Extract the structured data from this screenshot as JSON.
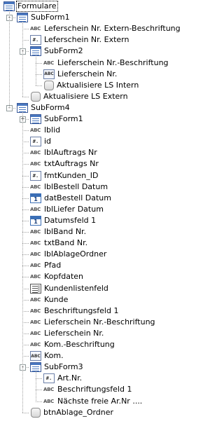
{
  "tree": [
    {
      "label": "Formulare",
      "icon": "form"
    },
    {
      "label": "SubForm1",
      "icon": "form"
    },
    {
      "label": "Leferschein Nr. Extern-Beschriftung",
      "icon": "label"
    },
    {
      "label": "Leferschein Nr. Extern",
      "icon": "textbox"
    },
    {
      "label": "SubForm2",
      "icon": "form"
    },
    {
      "label": "Lieferschein Nr.-Beschriftung",
      "icon": "label"
    },
    {
      "label": "Lieferschein Nr.",
      "icon": "textbox-abc"
    },
    {
      "label": "Aktualisiere LS Intern",
      "icon": "button"
    },
    {
      "label": "Aktualisiere LS Extern",
      "icon": "button"
    },
    {
      "label": "SubForm4",
      "icon": "form"
    },
    {
      "label": "SubForm1",
      "icon": "form"
    },
    {
      "label": "lblid",
      "icon": "label"
    },
    {
      "label": "id",
      "icon": "textbox"
    },
    {
      "label": "lblAuftrags Nr",
      "icon": "label"
    },
    {
      "label": "txtAuftrags Nr",
      "icon": "label"
    },
    {
      "label": "fmtKunden_ID",
      "icon": "textbox"
    },
    {
      "label": "lblBestell Datum",
      "icon": "label"
    },
    {
      "label": "datBestell Datum",
      "icon": "calendar"
    },
    {
      "label": "lblLiefer Datum",
      "icon": "label"
    },
    {
      "label": "Datumsfeld 1",
      "icon": "calendar"
    },
    {
      "label": "lblBand Nr.",
      "icon": "label"
    },
    {
      "label": "txtBand Nr.",
      "icon": "label"
    },
    {
      "label": "lblAblageOrdner",
      "icon": "label"
    },
    {
      "label": "Pfad",
      "icon": "label"
    },
    {
      "label": "Kopfdaten",
      "icon": "label"
    },
    {
      "label": "Kundenlistenfeld",
      "icon": "listbox"
    },
    {
      "label": "Kunde",
      "icon": "label"
    },
    {
      "label": "Beschriftungsfeld 1",
      "icon": "label"
    },
    {
      "label": "Lieferschein Nr.-Beschriftung",
      "icon": "label"
    },
    {
      "label": "Lieferschein Nr.",
      "icon": "label"
    },
    {
      "label": "Kom.-Beschriftung",
      "icon": "label"
    },
    {
      "label": "Kom.",
      "icon": "textbox-abc"
    },
    {
      "label": "SubForm3",
      "icon": "form"
    },
    {
      "label": "Art.Nr.",
      "icon": "textbox"
    },
    {
      "label": "Beschriftungsfeld 1",
      "icon": "label"
    },
    {
      "label": "Nächste freie Ar.Nr ....",
      "icon": "label"
    },
    {
      "label": "btnAblage_Ordner",
      "icon": "button"
    }
  ],
  "icon_glyphs": {
    "label": "ABC",
    "textbox": "#.",
    "textbox-abc": "ABC",
    "calendar": "1",
    "button": "",
    "form": "",
    "listbox": ""
  }
}
